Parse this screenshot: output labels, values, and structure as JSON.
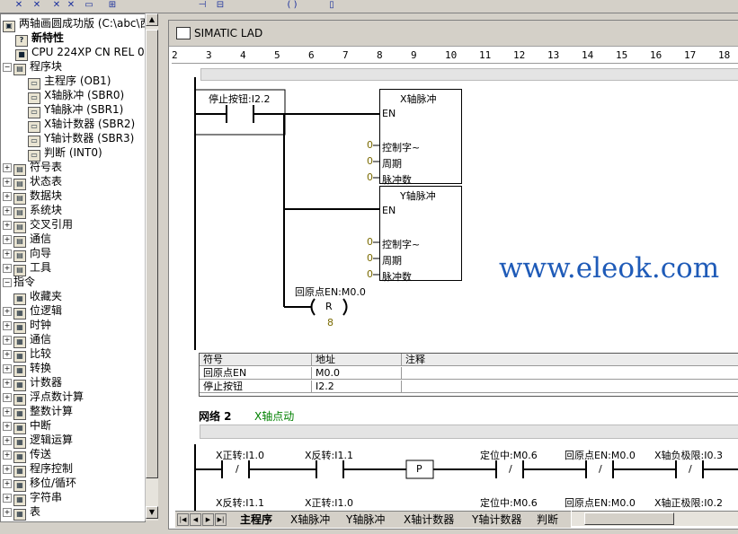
{
  "tree": {
    "project": "两轴画圆成功版 (C:\\abc\\西",
    "new_features": "新特性",
    "cpu": "CPU 224XP CN REL 02.0",
    "program_block": "程序块",
    "program_items": [
      "主程序 (OB1)",
      "X轴脉冲 (SBR0)",
      "Y轴脉冲 (SBR1)",
      "X轴计数器 (SBR2)",
      "Y轴计数器 (SBR3)",
      "判断 (INT0)"
    ],
    "nodes": [
      "符号表",
      "状态表",
      "数据块",
      "系统块",
      "交叉引用",
      "通信",
      "向导",
      "工具"
    ],
    "instructions": "指令",
    "instruction_items": [
      "收藏夹",
      "位逻辑",
      "时钟",
      "通信",
      "比较",
      "转换",
      "计数器",
      "浮点数计算",
      "整数计算",
      "中断",
      "逻辑运算",
      "传送",
      "程序控制",
      "移位/循环",
      "字符串",
      "表"
    ]
  },
  "editor": {
    "title": "SIMATIC LAD",
    "ruler": [
      "2",
      "3",
      "4",
      "5",
      "6",
      "7",
      "8",
      "9",
      "10",
      "11",
      "12",
      "13",
      "14",
      "15",
      "16",
      "17",
      "18"
    ]
  },
  "network1": {
    "stop_contact": "停止按钮:I2.2",
    "box1_title": "X轴脉冲",
    "box2_title": "Y轴脉冲",
    "en": "EN",
    "pins": [
      "控制字~",
      "周期",
      "脉冲数"
    ],
    "pin_value": "0",
    "reset_label": "回原点EN:M0.0",
    "reset_coil": "R",
    "reset_count": "8"
  },
  "symbols": {
    "headers": [
      "符号",
      "地址",
      "注释"
    ],
    "rows": [
      [
        "回原点EN",
        "M0.0",
        ""
      ],
      [
        "停止按钮",
        "I2.2",
        ""
      ]
    ]
  },
  "network2": {
    "label": "网络 2",
    "comment": "X轴点动",
    "row1": [
      "X正转:I1.0",
      "X反转:I1.1",
      "定位中:M0.6",
      "回原点EN:M0.0",
      "X轴负极限:I0.3"
    ],
    "row2": [
      "X反转:I1.1",
      "X正转:I1.0",
      "定位中:M0.6",
      "回原点EN:M0.0",
      "X轴正极限:I0.2"
    ],
    "p_label": "P",
    "nc_label": "/"
  },
  "tabs": [
    "主程序",
    "X轴脉冲",
    "Y轴脉冲",
    "X轴计数器",
    "Y轴计数器",
    "判断"
  ],
  "watermark": "www.eleok.com"
}
